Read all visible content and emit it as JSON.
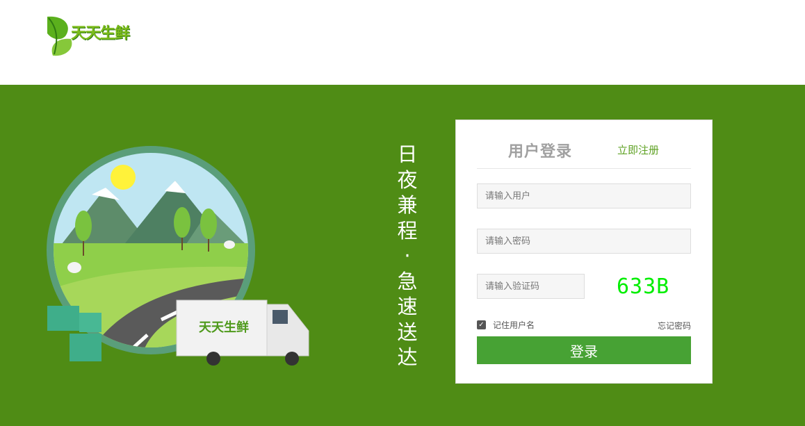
{
  "header": {
    "logo_text": "天天生鲜"
  },
  "slogan": [
    "日",
    "夜",
    "兼",
    "程",
    "·",
    "急",
    "速",
    "送",
    "达"
  ],
  "illustration": {
    "truck_logo_text": "天天生鲜"
  },
  "login": {
    "title": "用户登录",
    "register_link": "立即注册",
    "username_placeholder": "请输入用户",
    "password_placeholder": "请输入密码",
    "captcha_placeholder": "请输入验证码",
    "captcha_code": "633B",
    "remember_label": "记住用户名",
    "remember_checked": true,
    "forgot_link": "忘记密码",
    "submit_label": "登录"
  },
  "colors": {
    "brand_green": "#4f8c15",
    "button_green": "#47a234",
    "link_green": "#5fa224",
    "captcha_green": "#00ee00"
  }
}
